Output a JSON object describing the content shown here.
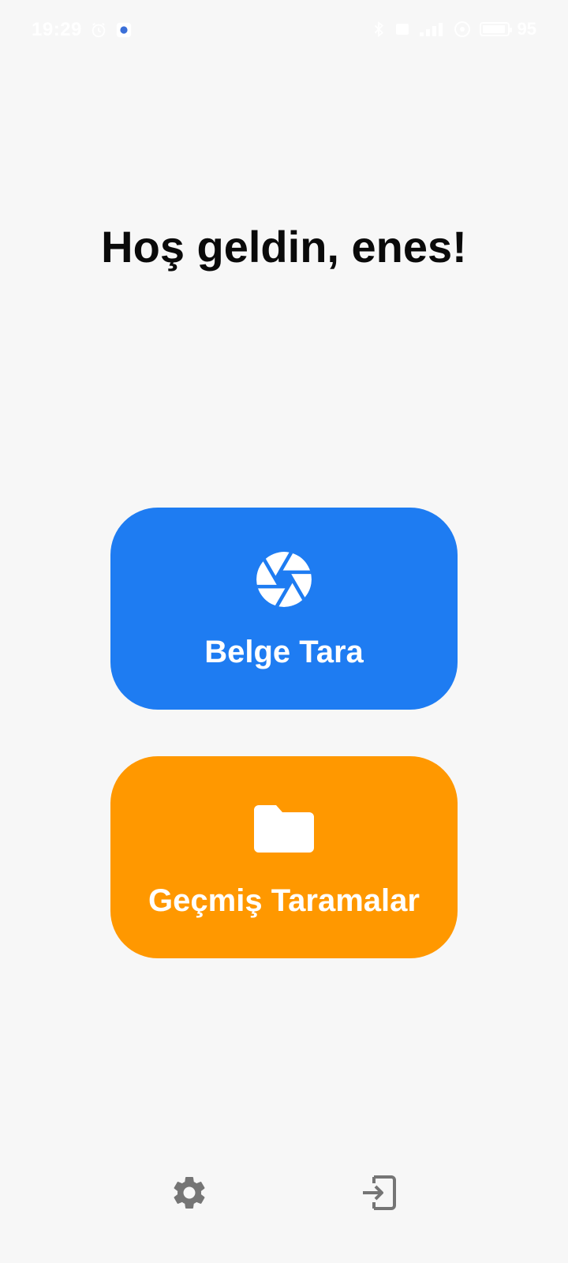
{
  "status_bar": {
    "time": "19:29",
    "battery_percent": "95",
    "icons": [
      "alarm-icon",
      "app-notification-icon",
      "bluetooth-icon",
      "sim-icon",
      "signal-icon",
      "wifi-icon",
      "battery-icon"
    ]
  },
  "greeting": "Hoş geldin, enes!",
  "actions": {
    "scan": {
      "label": "Belge Tara",
      "icon": "camera-aperture-icon",
      "color": "#1e7cf2"
    },
    "history": {
      "label": "Geçmiş Taramalar",
      "icon": "folder-icon",
      "color": "#ff9800"
    }
  },
  "bottom": {
    "settings_icon": "gear-icon",
    "logout_icon": "logout-icon",
    "icon_color": "#757575"
  }
}
